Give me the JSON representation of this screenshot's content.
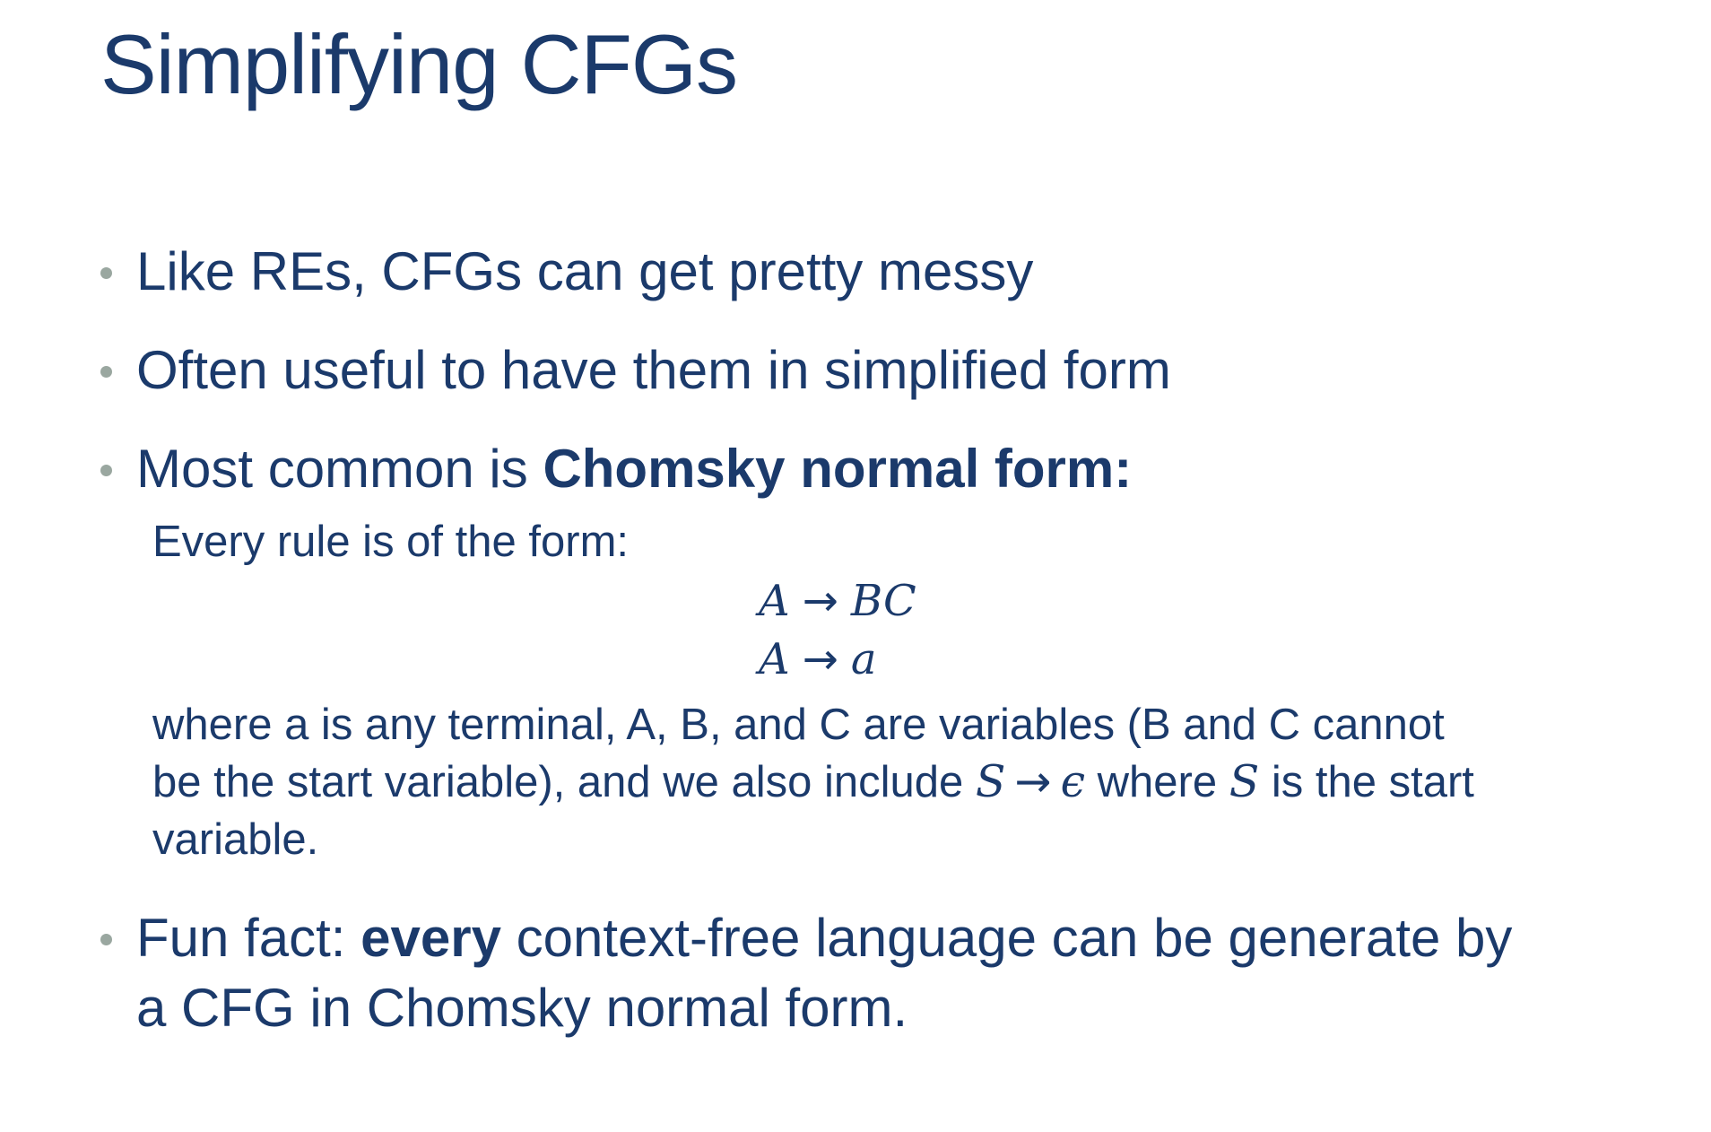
{
  "slide": {
    "title": "Simplifying CFGs",
    "bullets": [
      {
        "text": "Like REs, CFGs can get pretty messy"
      },
      {
        "text": "Often useful to have them in simplified form"
      },
      {
        "prefix": "Most common is ",
        "bold": "Chomsky normal form:"
      },
      {
        "prefix": "Fun fact: ",
        "bold": "every",
        "line1_rest": " context-free language can be generate by",
        "line2": "a CFG in Chomsky normal form."
      }
    ],
    "intro": "Every rule is of the form:",
    "rules": [
      {
        "lhs": "A",
        "arrow": "→",
        "rhs": "BC"
      },
      {
        "lhs": "A",
        "arrow": "→",
        "rhs": "a"
      }
    ],
    "explanation": {
      "line1": "where a is any terminal, A, B, and C are variables (B and C cannot",
      "line2_a": "be the start variable), and we also include ",
      "math_s": "S",
      "math_arrow": "→",
      "math_eps": "ϵ",
      "line2_b": " where ",
      "math_s2": "S",
      "line2_c": " is the start",
      "line3": "variable."
    }
  }
}
